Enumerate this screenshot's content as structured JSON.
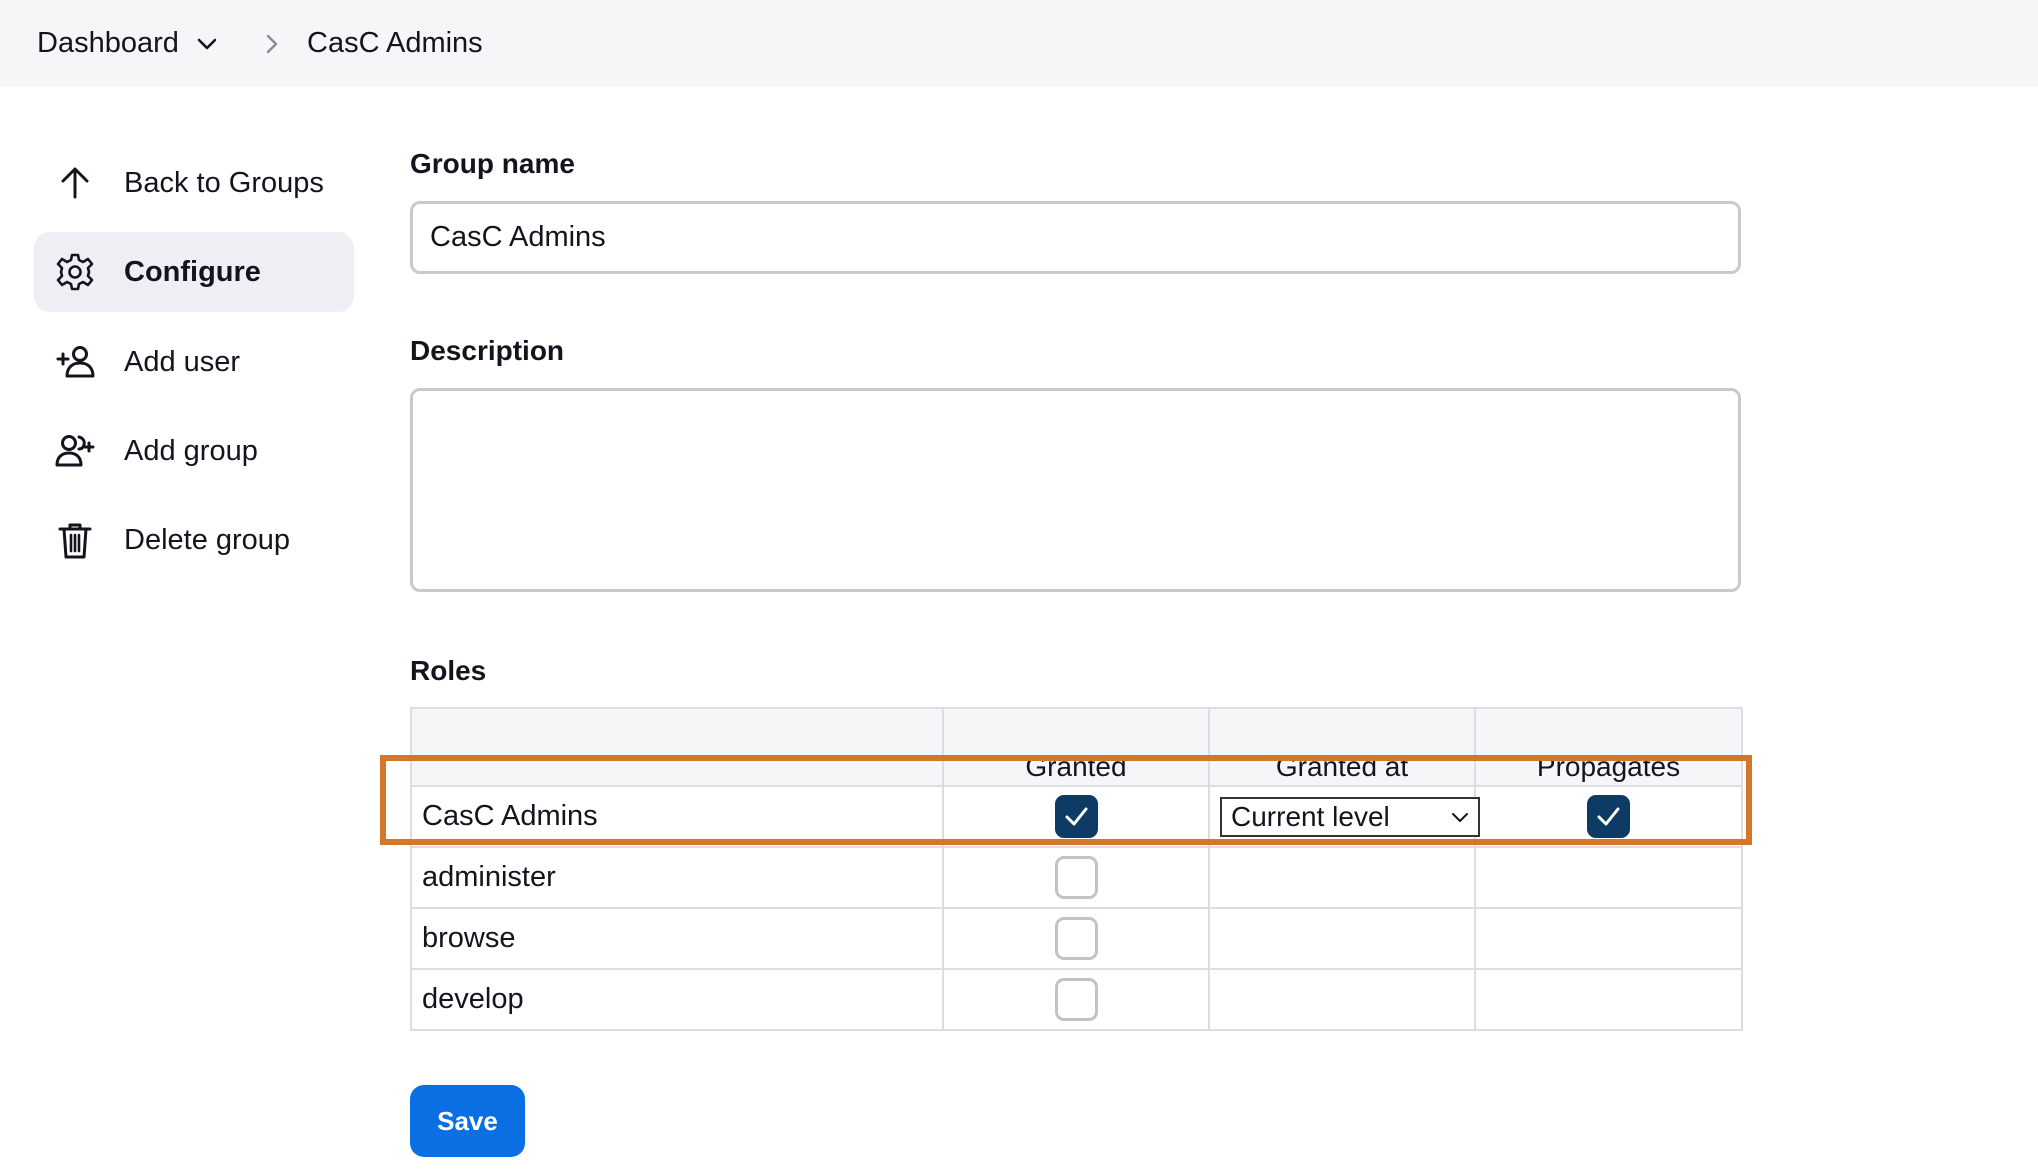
{
  "breadcrumb": {
    "dashboard": "Dashboard",
    "current": "CasC Admins"
  },
  "sidebar": {
    "items": [
      {
        "label": "Back to Groups",
        "icon": "arrow-up-icon",
        "active": false
      },
      {
        "label": "Configure",
        "icon": "gear-icon",
        "active": true
      },
      {
        "label": "Add user",
        "icon": "add-user-icon",
        "active": false
      },
      {
        "label": "Add group",
        "icon": "add-group-icon",
        "active": false
      },
      {
        "label": "Delete group",
        "icon": "trash-icon",
        "active": false
      }
    ]
  },
  "form": {
    "group_name_label": "Group name",
    "group_name_value": "CasC Admins",
    "description_label": "Description",
    "description_value": "",
    "roles_label": "Roles"
  },
  "roles_table": {
    "headers": [
      "",
      "Granted",
      "Granted at",
      "Propagates"
    ],
    "rows": [
      {
        "name": "CasC Admins",
        "granted": true,
        "granted_at": "Current level",
        "propagates": true
      },
      {
        "name": "administer",
        "granted": false
      },
      {
        "name": "browse",
        "granted": false
      },
      {
        "name": "develop",
        "granted": false
      }
    ]
  },
  "save_label": "Save",
  "colors": {
    "accent": "#0b6fe4",
    "checkbox_checked": "#0d3b66",
    "highlight": "#d3772a",
    "topbar_bg": "#f6f6f8"
  }
}
